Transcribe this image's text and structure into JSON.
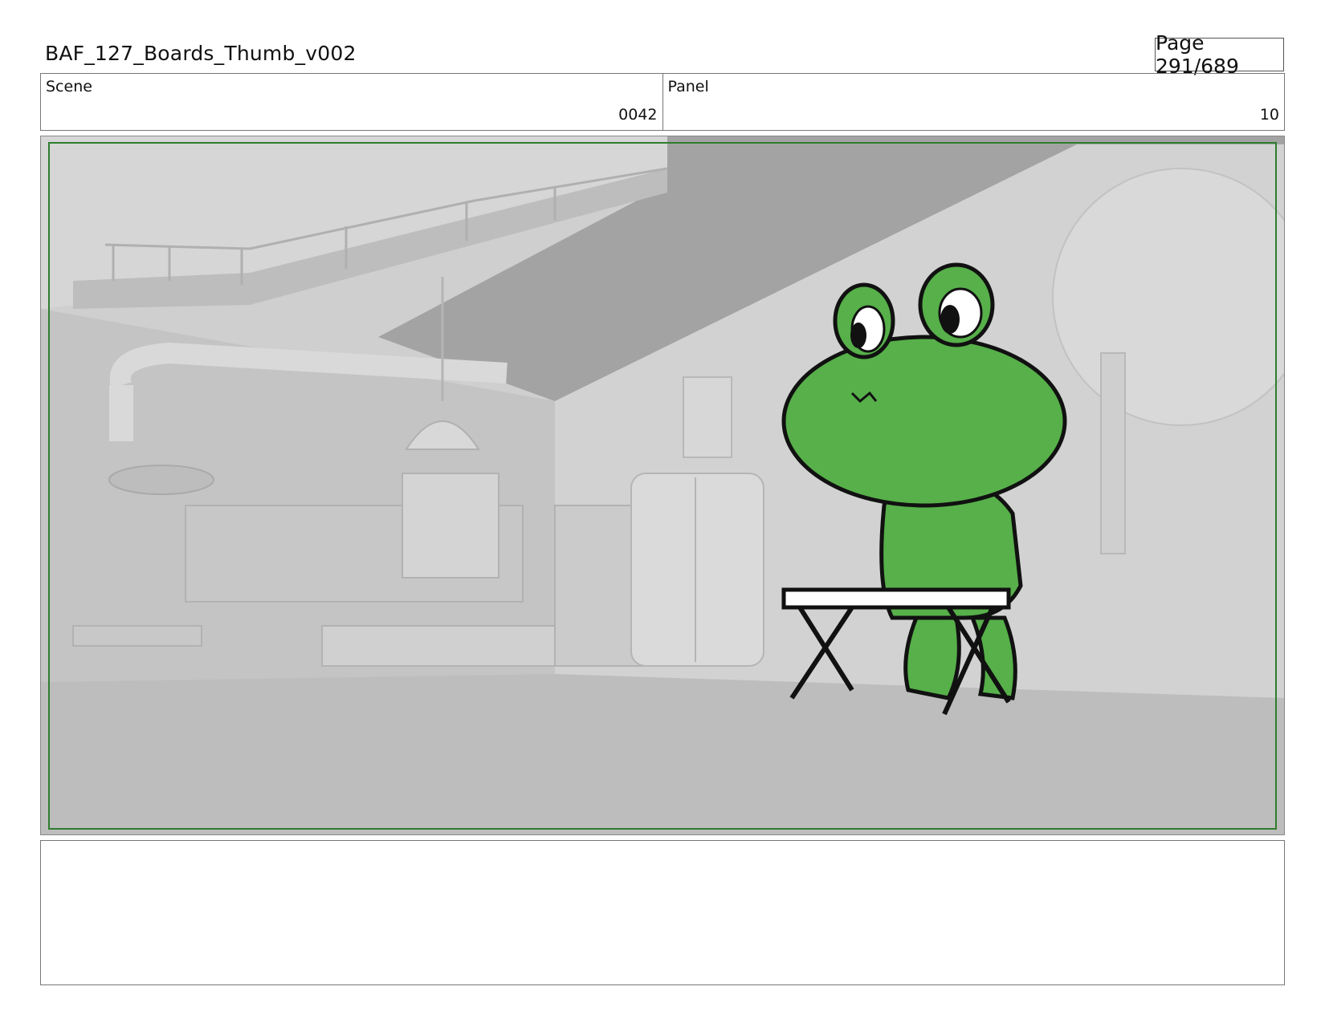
{
  "header": {
    "document_title": "BAF_127_Boards_Thumb_v002",
    "page_label": "Page 291/689"
  },
  "info": {
    "scene_label": "Scene",
    "scene_value": "0042",
    "panel_label": "Panel",
    "panel_value": "10"
  },
  "colors": {
    "safe_frame": "#2e7d2e",
    "frog_green": "#57b04a",
    "room_grey": "#c9c9c9"
  },
  "notes": {
    "text": ""
  }
}
